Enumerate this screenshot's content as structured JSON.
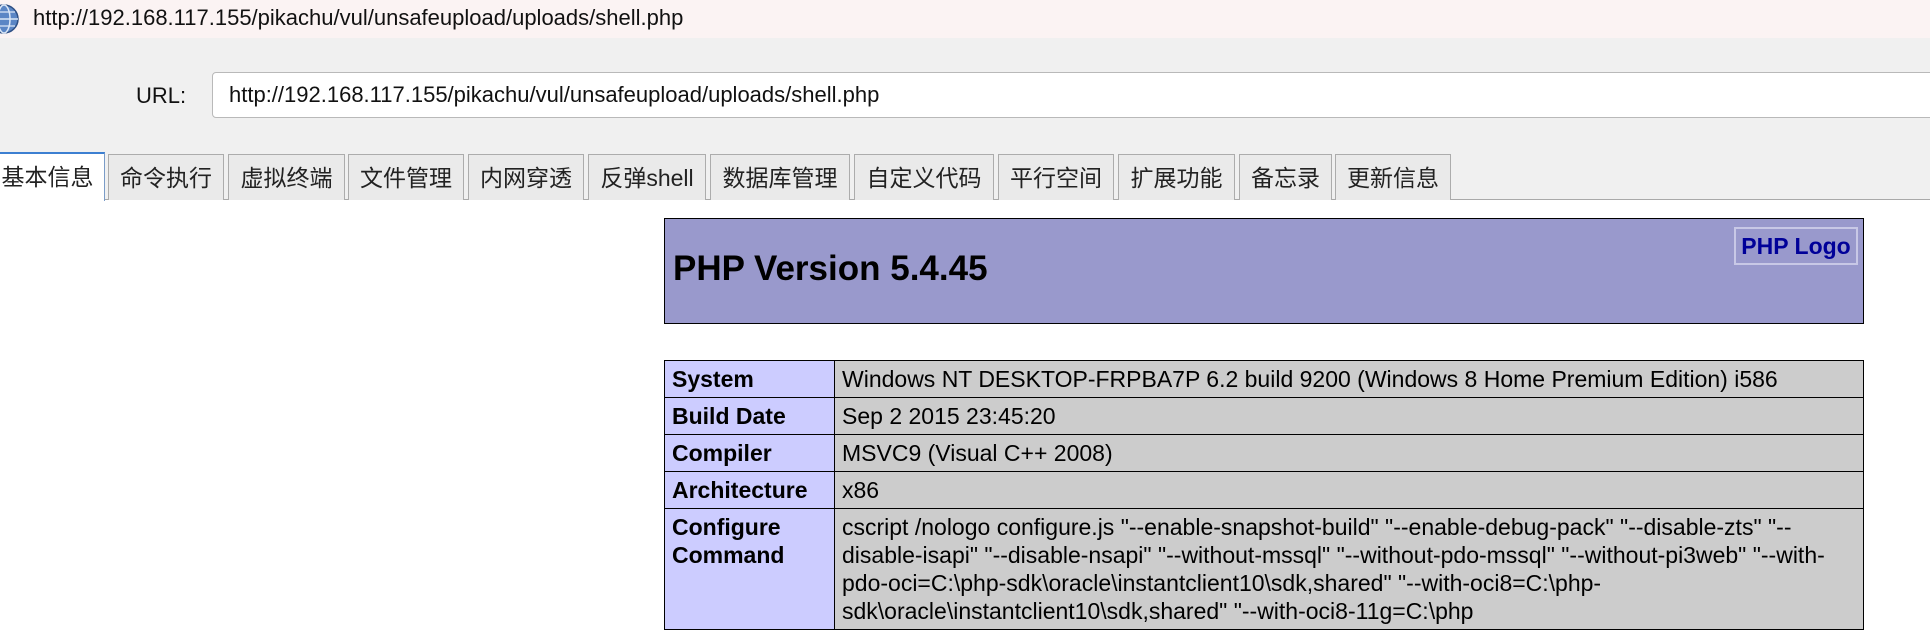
{
  "window": {
    "title": "http://192.168.117.155/pikachu/vul/unsafeupload/uploads/shell.php",
    "icon": "globe-icon"
  },
  "url_bar": {
    "label": "URL:",
    "value": "http://192.168.117.155/pikachu/vul/unsafeupload/uploads/shell.php"
  },
  "tabs": [
    {
      "label": "基本信息",
      "active": true
    },
    {
      "label": "命令执行",
      "active": false
    },
    {
      "label": "虚拟终端",
      "active": false
    },
    {
      "label": "文件管理",
      "active": false
    },
    {
      "label": "内网穿透",
      "active": false
    },
    {
      "label": "反弹shell",
      "active": false
    },
    {
      "label": "数据库管理",
      "active": false
    },
    {
      "label": "自定义代码",
      "active": false
    },
    {
      "label": "平行空间",
      "active": false
    },
    {
      "label": "扩展功能",
      "active": false
    },
    {
      "label": "备忘录",
      "active": false
    },
    {
      "label": "更新信息",
      "active": false
    }
  ],
  "phpinfo": {
    "version_title": "PHP Version 5.4.45",
    "logo_alt": "PHP Logo",
    "rows": [
      {
        "key": "System",
        "value": "Windows NT DESKTOP-FRPBA7P 6.2 build 9200 (Windows 8 Home Premium Edition) i586"
      },
      {
        "key": "Build Date",
        "value": "Sep 2 2015 23:45:20"
      },
      {
        "key": "Compiler",
        "value": "MSVC9 (Visual C++ 2008)"
      },
      {
        "key": "Architecture",
        "value": "x86"
      },
      {
        "key": "Configure Command",
        "value": "cscript /nologo configure.js \"--enable-snapshot-build\" \"--enable-debug-pack\" \"--disable-zts\" \"--disable-isapi\" \"--disable-nsapi\" \"--without-mssql\" \"--without-pdo-mssql\" \"--without-pi3web\" \"--with-pdo-oci=C:\\php-sdk\\oracle\\instantclient10\\sdk,shared\" \"--with-oci8=C:\\php-sdk\\oracle\\instantclient10\\sdk,shared\" \"--with-oci8-11g=C:\\php"
      }
    ]
  },
  "colors": {
    "header_bg": "#9999cc",
    "key_cell_bg": "#ccccff",
    "value_cell_bg": "#cccccc",
    "logo_text": "#000099",
    "active_tab_accent": "#3c7fd1"
  }
}
